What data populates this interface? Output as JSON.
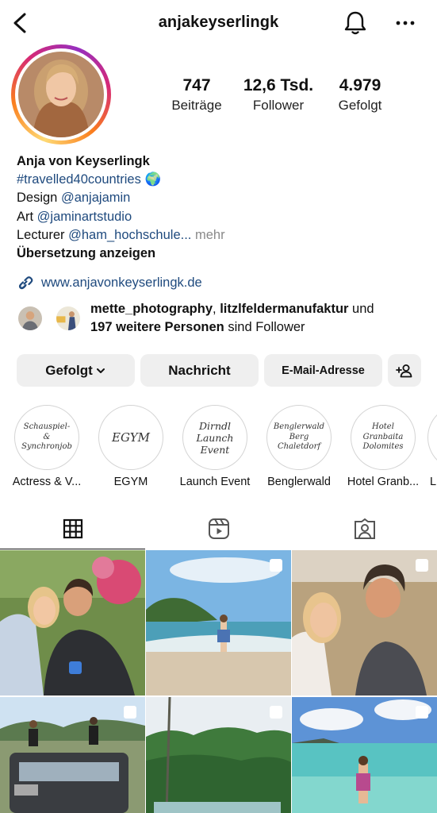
{
  "header": {
    "username": "anjakeyserlingk",
    "icons": [
      "back-icon",
      "bell-icon",
      "more-icon"
    ]
  },
  "stats": [
    {
      "value": "747",
      "label": "Beiträge"
    },
    {
      "value": "12,6 Tsd.",
      "label": "Follower"
    },
    {
      "value": "4.979",
      "label": "Gefolgt"
    }
  ],
  "bio": {
    "name": "Anja von Keyserlingk",
    "hashtag": "#travelled40countries",
    "globe": "🌍",
    "design_prefix": "Design ",
    "design_handle": "@anjajamin",
    "art_prefix": "Art ",
    "art_handle": "@jaminartstudio",
    "lecturer_prefix": "Lecturer ",
    "lecturer_handle": "@ham_hochschule...",
    "more": " mehr",
    "translate": "Übersetzung anzeigen",
    "website": "www.anjavonkeyserlingk.de"
  },
  "followed_by": {
    "name1": "mette_photography",
    "sep": ", ",
    "name2": "litzlfeldermanufaktur",
    "and": " und",
    "others": "197 weitere Personen",
    "suffix": " sind Follower"
  },
  "buttons": {
    "following": "Gefolgt",
    "message": "Nachricht",
    "email": "E-Mail-Adresse"
  },
  "highlights": [
    {
      "label": "Actress & V...",
      "cover": "Schauspiel- & Synchronjob"
    },
    {
      "label": "EGYM",
      "cover": "EGYM"
    },
    {
      "label": "Launch Event",
      "cover": "Dirndl Launch Event"
    },
    {
      "label": "Benglerwald",
      "cover": "Benglerwald Berg Chaletdorf"
    },
    {
      "label": "Hotel Granb...",
      "cover": "Hotel Granbaita Dolomites"
    },
    {
      "label": "L",
      "cover": ""
    }
  ],
  "tabs": [
    "grid-icon",
    "reels-icon",
    "tagged-icon"
  ],
  "colors": {
    "link": "#1f4a7e",
    "button_bg": "#efefef",
    "ring": [
      "#feda75",
      "#fa7e1e",
      "#d62976",
      "#962fbf"
    ]
  }
}
